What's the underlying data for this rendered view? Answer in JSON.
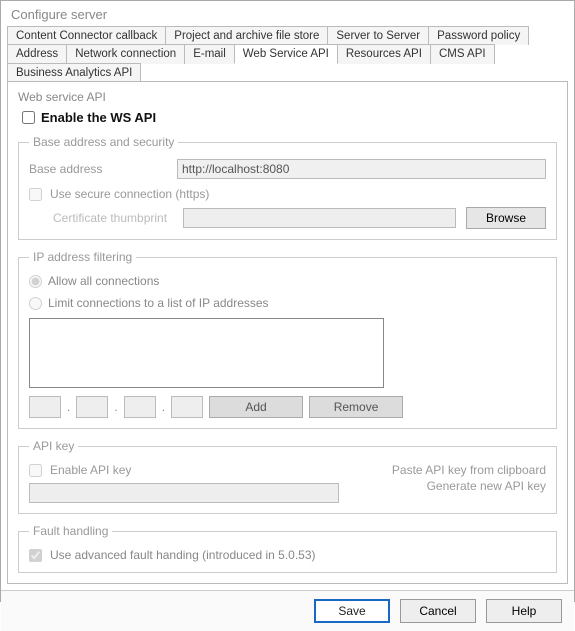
{
  "window": {
    "title": "Configure server"
  },
  "tabs": {
    "row1": [
      "Content Connector callback",
      "Project and archive file store",
      "Server to Server",
      "Password policy"
    ],
    "row2": [
      "Address",
      "Network connection",
      "E-mail",
      "Web Service API",
      "Resources API",
      "CMS API",
      "Business Analytics API"
    ],
    "active": "Web Service API"
  },
  "panel": {
    "title": "Web service API",
    "enable_label": "Enable the WS API"
  },
  "base": {
    "legend": "Base address and security",
    "address_label": "Base address",
    "address_value": "http://localhost:8080",
    "secure_label": "Use secure connection (https)",
    "cert_label": "Certificate thumbprint",
    "browse": "Browse"
  },
  "ipfilter": {
    "legend": "IP address filtering",
    "allow_all": "Allow all connections",
    "limit": "Limit connections to a list of IP addresses",
    "add": "Add",
    "remove": "Remove"
  },
  "apikey": {
    "legend": "API key",
    "enable_label": "Enable API key",
    "paste": "Paste API key from clipboard",
    "generate": "Generate new API key"
  },
  "fault": {
    "legend": "Fault handling",
    "advanced": "Use advanced fault handing (introduced in 5.0.53)"
  },
  "footer": {
    "save": "Save",
    "cancel": "Cancel",
    "help": "Help"
  }
}
